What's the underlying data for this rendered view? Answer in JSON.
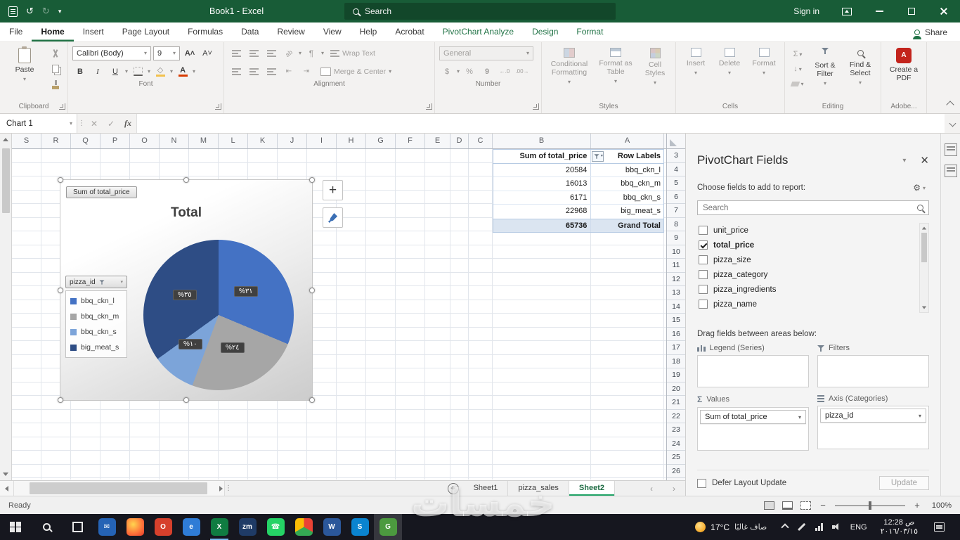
{
  "title_bar": {
    "title": "Book1 - Excel",
    "search_placeholder": "Search",
    "sign_in": "Sign in"
  },
  "ribbon": {
    "tabs": [
      {
        "label": "File"
      },
      {
        "label": "Home",
        "active": true
      },
      {
        "label": "Insert"
      },
      {
        "label": "Page Layout"
      },
      {
        "label": "Formulas"
      },
      {
        "label": "Data"
      },
      {
        "label": "Review"
      },
      {
        "label": "View"
      },
      {
        "label": "Help"
      },
      {
        "label": "Acrobat"
      },
      {
        "label": "PivotChart Analyze",
        "contextual": true
      },
      {
        "label": "Design",
        "contextual": true
      },
      {
        "label": "Format",
        "contextual": true
      }
    ],
    "share_label": "Share",
    "clipboard": {
      "label": "Clipboard",
      "paste": "Paste"
    },
    "font": {
      "label": "Font",
      "name": "Calibri (Body)",
      "size": "9"
    },
    "alignment": {
      "label": "Alignment",
      "wrap": "Wrap Text",
      "merge": "Merge & Center"
    },
    "number": {
      "label": "Number",
      "format": "General"
    },
    "styles": {
      "label": "Styles",
      "conditional": "Conditional Formatting",
      "format_table": "Format as Table",
      "cell_styles": "Cell Styles"
    },
    "cells": {
      "label": "Cells",
      "insert": "Insert",
      "delete": "Delete",
      "format": "Format"
    },
    "editing": {
      "label": "Editing",
      "sort": "Sort & Filter",
      "find": "Find & Select"
    },
    "adobe": {
      "label": "Adobe...",
      "create_pdf": "Create a PDF"
    }
  },
  "formula_bar": {
    "name_box": "Chart 1",
    "fx": "fx"
  },
  "sheet": {
    "columns": [
      "S",
      "R",
      "Q",
      "P",
      "O",
      "N",
      "M",
      "L",
      "K",
      "J",
      "I",
      "H",
      "G",
      "F",
      "E",
      "D",
      "C",
      "B",
      "A"
    ],
    "rows": [
      "3",
      "4",
      "5",
      "6",
      "7",
      "8",
      "9",
      "10",
      "11",
      "12",
      "13",
      "14",
      "15",
      "16",
      "17",
      "18",
      "19",
      "20",
      "21",
      "22",
      "23",
      "24",
      "25",
      "26"
    ],
    "pivot": {
      "value_header": "Sum of total_price",
      "label_header": "Row Labels",
      "rows": [
        {
          "value": "20584",
          "label": "bbq_ckn_l"
        },
        {
          "value": "16013",
          "label": "bbq_ckn_m"
        },
        {
          "value": "6171",
          "label": "bbq_ckn_s"
        },
        {
          "value": "22968",
          "label": "big_meat_s"
        }
      ],
      "total": {
        "value": "65736",
        "label": "Grand Total"
      }
    }
  },
  "chart_data": {
    "type": "pie",
    "title": "Total",
    "series_name": "Sum of total_price",
    "legend_filter_button": "pizza_id",
    "categories": [
      "bbq_ckn_l",
      "bbq_ckn_m",
      "bbq_ckn_s",
      "big_meat_s"
    ],
    "values": [
      20584,
      16013,
      6171,
      22968
    ],
    "percent_labels": [
      "%٣١",
      "%٢٤",
      "%١٠",
      "%٣٥"
    ],
    "colors": [
      "#4472c4",
      "#a6a6a6",
      "#7ca4d9",
      "#2e4d85"
    ],
    "legend_position": "left",
    "legend_items": [
      {
        "label": "bbq_ckn_l",
        "color": "#4472c4"
      },
      {
        "label": "bbq_ckn_m",
        "color": "#a6a6a6"
      },
      {
        "label": "bbq_ckn_s",
        "color": "#7ca4d9"
      },
      {
        "label": "big_meat_s",
        "color": "#2e4d85"
      }
    ]
  },
  "fields_pane": {
    "title": "PivotChart Fields",
    "subtitle": "Choose fields to add to report:",
    "search_placeholder": "Search",
    "fields": [
      {
        "label": "unit_price",
        "checked": false
      },
      {
        "label": "total_price",
        "checked": true
      },
      {
        "label": "pizza_size",
        "checked": false
      },
      {
        "label": "pizza_category",
        "checked": false
      },
      {
        "label": "pizza_ingredients",
        "checked": false
      },
      {
        "label": "pizza_name",
        "checked": false
      }
    ],
    "drag_hint": "Drag fields between areas below:",
    "areas": {
      "legend_label": "Legend (Series)",
      "filters_label": "Filters",
      "values_label": "Values",
      "axis_label": "Axis (Categories)",
      "values_items": [
        "Sum of total_price"
      ],
      "axis_items": [
        "pizza_id"
      ]
    },
    "defer_label": "Defer Layout Update",
    "update_label": "Update"
  },
  "sheet_tabs": {
    "tabs": [
      {
        "label": "Sheet1"
      },
      {
        "label": "pizza_sales"
      },
      {
        "label": "Sheet2",
        "active": true
      }
    ]
  },
  "status_bar": {
    "ready": "Ready",
    "zoom": "100%"
  },
  "taskbar": {
    "weather": {
      "temp": "17°C",
      "condition": "صاف غالبًا"
    },
    "tray_lang": "ENG",
    "clock": {
      "time": "ص 12:28",
      "date": "٢٠١٦/٠٣/١٥"
    },
    "apps": [
      {
        "name": "mail-icon",
        "glyph": "✉",
        "bg": "#2563b5"
      },
      {
        "name": "firefox-icon",
        "glyph": "",
        "bg": "radial-gradient(circle at 38% 35%, #ffd54f, #ff7139 60%, #e3392b)"
      },
      {
        "name": "opera-icon",
        "glyph": "O",
        "bg": "#d6402c"
      },
      {
        "name": "edge-icon",
        "glyph": "e",
        "bg": "#2f7cd6"
      },
      {
        "name": "excel-icon",
        "glyph": "X",
        "bg": "#107c41",
        "active": true
      },
      {
        "name": "zoom-icon",
        "glyph": "zm",
        "bg": "#1f3b66"
      },
      {
        "name": "whatsapp-icon",
        "glyph": "☎",
        "bg": "#25d366"
      },
      {
        "name": "chrome-icon",
        "glyph": "",
        "bg": "conic-gradient(#ea4335 0 120deg, #34a853 120deg 240deg, #fbbc05 240deg 360deg)"
      },
      {
        "name": "word-icon",
        "glyph": "W",
        "bg": "#2b579a"
      },
      {
        "name": "skype-icon",
        "glyph": "S",
        "bg": "#0a84d0"
      },
      {
        "name": "greenshot-icon",
        "glyph": "G",
        "bg": "#4c9a3f",
        "focused": true
      }
    ]
  },
  "watermark": "خمسات"
}
